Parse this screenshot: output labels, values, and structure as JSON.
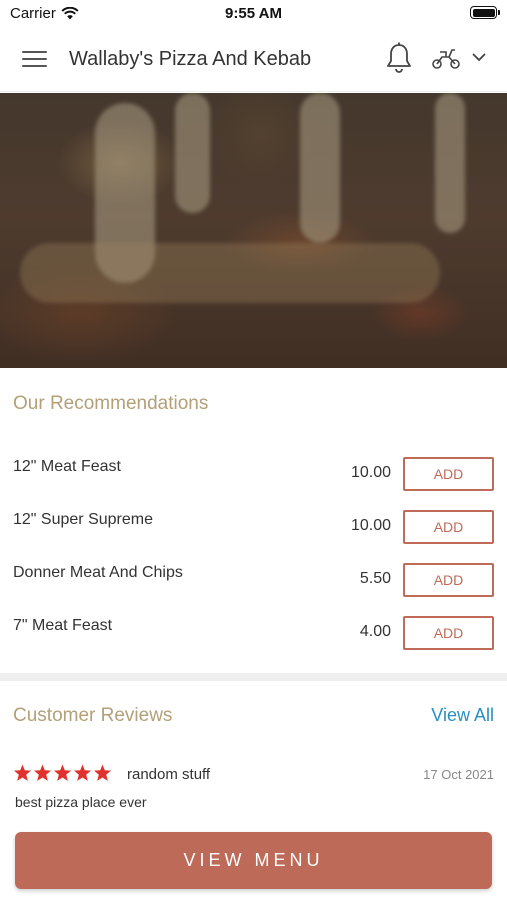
{
  "status_bar": {
    "carrier": "Carrier",
    "time": "9:55 AM"
  },
  "header": {
    "title": "Wallaby's Pizza And Kebab",
    "icons": [
      "menu-icon",
      "bell-icon",
      "scooter-icon",
      "chevron-down-icon"
    ]
  },
  "hero": {
    "image": "pizza-cheese-pull-photo"
  },
  "recommendations": {
    "title": "Our Recommendations",
    "add_label": "ADD",
    "items": [
      {
        "name": "12\" Meat Feast",
        "price": "10.00"
      },
      {
        "name": "12\" Super Supreme",
        "price": "10.00"
      },
      {
        "name": "Donner Meat And Chips",
        "price": "5.50"
      },
      {
        "name": "7\" Meat Feast",
        "price": "4.00"
      }
    ]
  },
  "reviews": {
    "title": "Customer Reviews",
    "view_all": "View All",
    "items": [
      {
        "rating": 5,
        "author": "random stuff",
        "date": "17 Oct 2021",
        "text": "best pizza place ever"
      }
    ]
  },
  "footer": {
    "view_menu": "VIEW MENU"
  },
  "colors": {
    "accent": "#bd6b58",
    "section_title": "#b3a079",
    "link": "#2a8fc4",
    "star": "#e0312c"
  }
}
